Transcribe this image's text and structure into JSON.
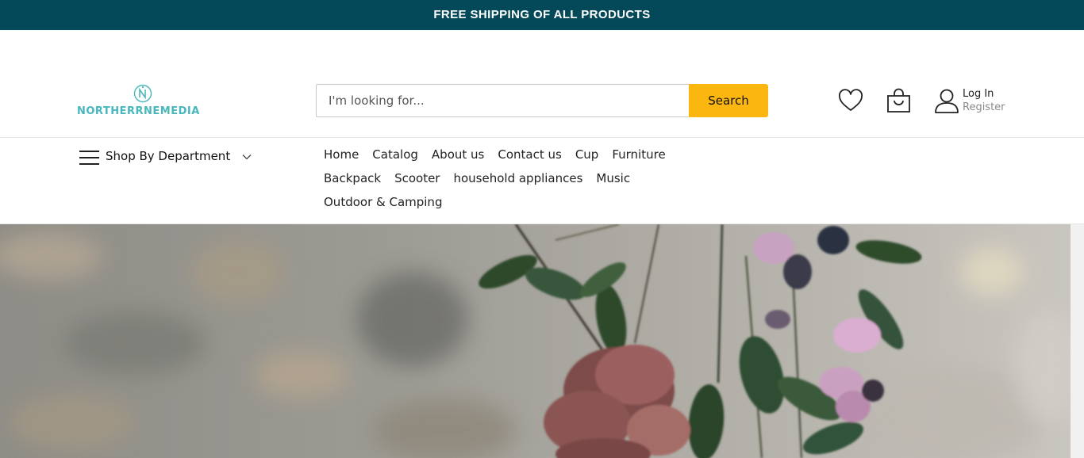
{
  "announcement": "FREE SHIPPING OF ALL PRODUCTS",
  "logo": {
    "text": "NORTHERRNEMEDIA",
    "brand_color": "#48b7bc"
  },
  "search": {
    "placeholder": "I'm looking for...",
    "value": "",
    "button_label": "Search",
    "button_color": "#fbb710"
  },
  "header_icons": [
    "heart-icon",
    "shopping-bag-icon",
    "user-icon"
  ],
  "account": {
    "login_label": "Log In",
    "register_label": "Register"
  },
  "department": {
    "label": "Shop By Department"
  },
  "nav": {
    "row1": [
      "Home",
      "Catalog",
      "About us",
      "Contact us",
      "Cup",
      "Furniture"
    ],
    "row2": [
      "Backpack",
      "Scooter",
      "household appliances",
      "Music"
    ],
    "row3": [
      "Outdoor & Camping"
    ]
  },
  "colors": {
    "topbar": "#04495a",
    "accent": "#fbb710"
  }
}
